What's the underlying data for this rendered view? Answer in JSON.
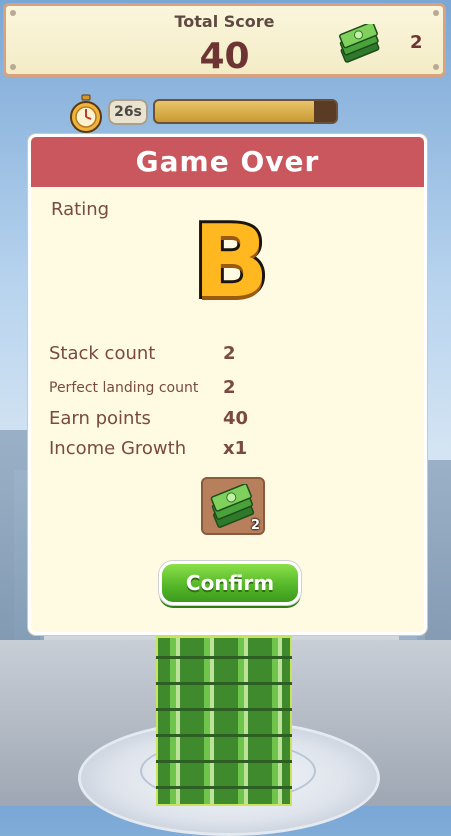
{
  "hud": {
    "total_score_label": "Total Score",
    "total_score_value": "40",
    "cash_icon": "cash-stack-icon",
    "cash_count": "2",
    "timer_icon": "stopwatch-icon",
    "timer_text": "26s",
    "timer_progress": 0.88
  },
  "dialog": {
    "title": "Game Over",
    "rating_label": "Rating",
    "rating_grade": "B",
    "stats": [
      {
        "label": "Stack count",
        "value": "2"
      },
      {
        "label": "Perfect landing count",
        "value": "2"
      },
      {
        "label": "Earn points",
        "value": "40"
      },
      {
        "label": "Income Growth",
        "value": "x1"
      }
    ],
    "reward": {
      "icon": "cash-stack-icon",
      "count": "2"
    },
    "confirm_label": "Confirm"
  },
  "colors": {
    "header_red": "#c9575d",
    "panel_cream": "#fffbe3",
    "text_brown": "#7a4a40",
    "grade_orange": "#ffb820",
    "button_green": "#56b82a"
  }
}
